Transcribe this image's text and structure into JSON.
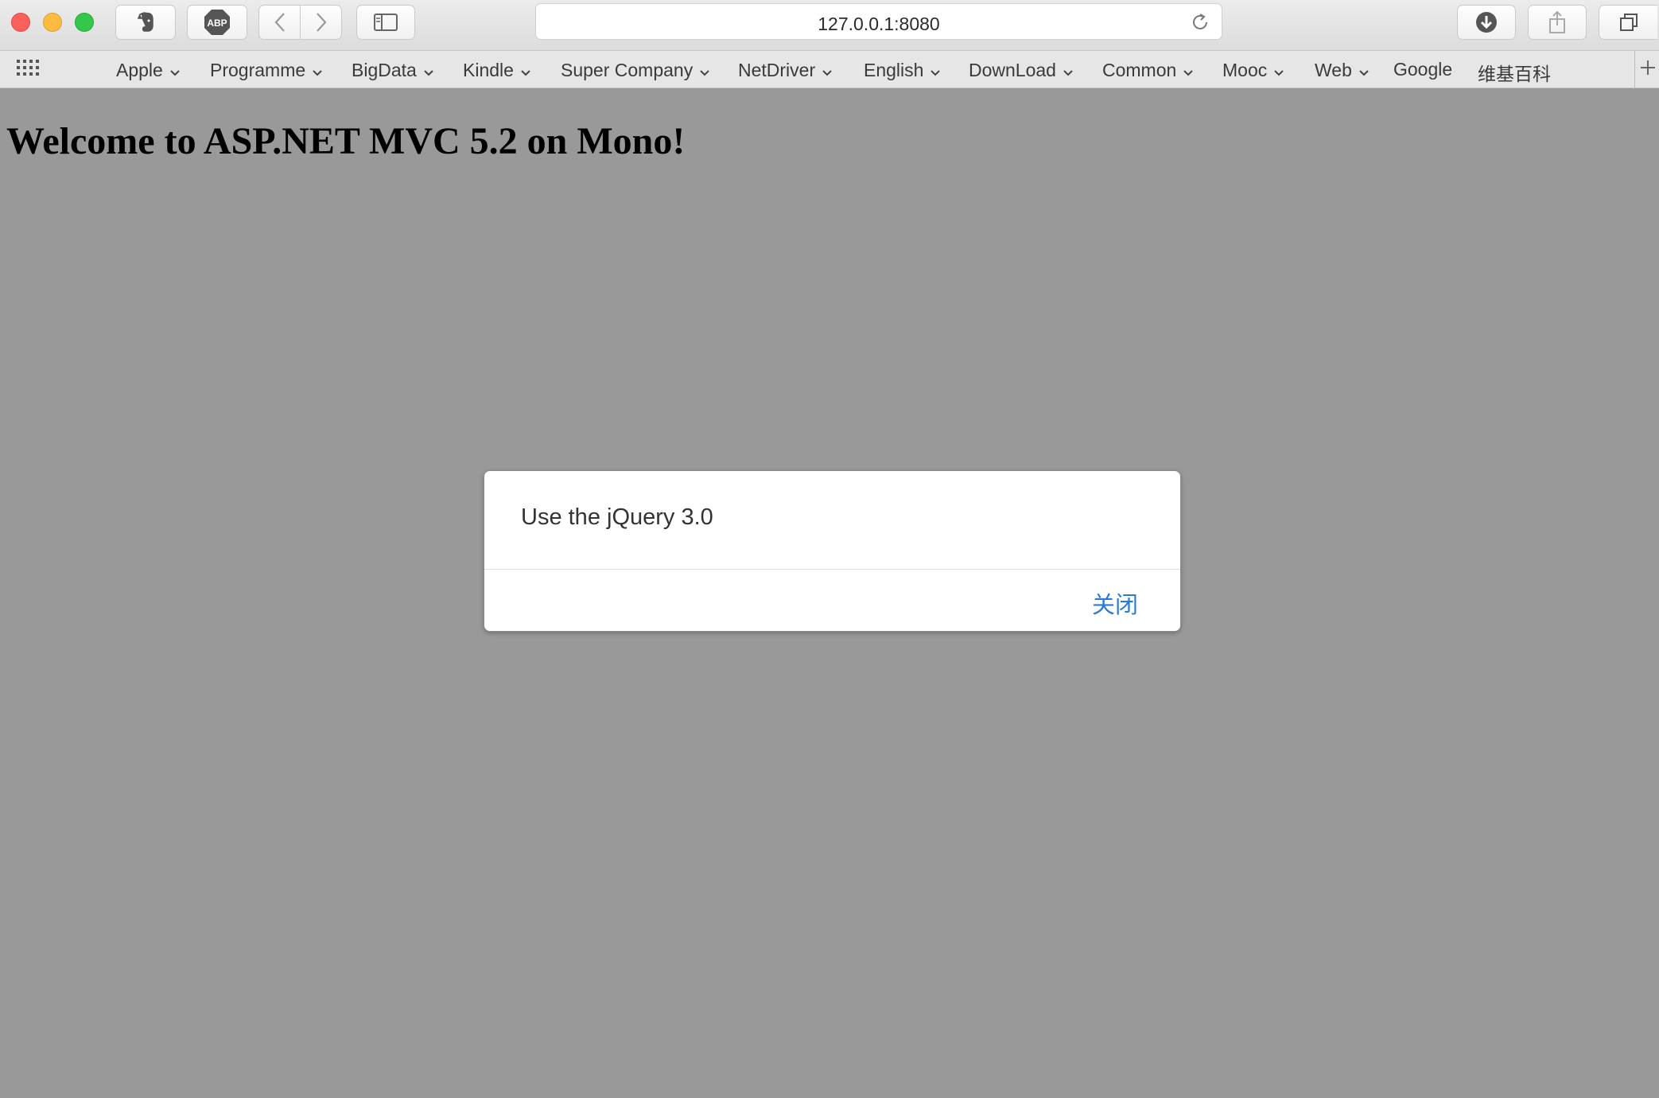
{
  "window": {
    "controls": [
      "close",
      "minimize",
      "zoom"
    ]
  },
  "toolbar": {
    "extensions": [
      {
        "name": "evernote-icon"
      },
      {
        "name": "adblock-icon",
        "label": "ABP"
      }
    ],
    "address": "127.0.0.1:8080"
  },
  "bookmarks": {
    "items": [
      {
        "label": "Apple",
        "has_menu": true
      },
      {
        "label": "Programme",
        "has_menu": true
      },
      {
        "label": "BigData",
        "has_menu": true
      },
      {
        "label": "Kindle",
        "has_menu": true
      },
      {
        "label": "Super Company",
        "has_menu": true
      },
      {
        "label": "NetDriver",
        "has_menu": true
      },
      {
        "label": "English",
        "has_menu": true
      },
      {
        "label": "DownLoad",
        "has_menu": true
      },
      {
        "label": "Common",
        "has_menu": true
      },
      {
        "label": "Mooc",
        "has_menu": true
      },
      {
        "label": "Web",
        "has_menu": true
      },
      {
        "label": "Google",
        "has_menu": false
      },
      {
        "label": "维基百科",
        "has_menu": false
      }
    ]
  },
  "page": {
    "heading": "Welcome to ASP.NET MVC 5.2 on Mono!"
  },
  "dialog": {
    "message": "Use the jQuery 3.0",
    "close_label": "关闭"
  },
  "colors": {
    "overlay_background": "#999999",
    "dialog_link": "#2a7ad6"
  }
}
